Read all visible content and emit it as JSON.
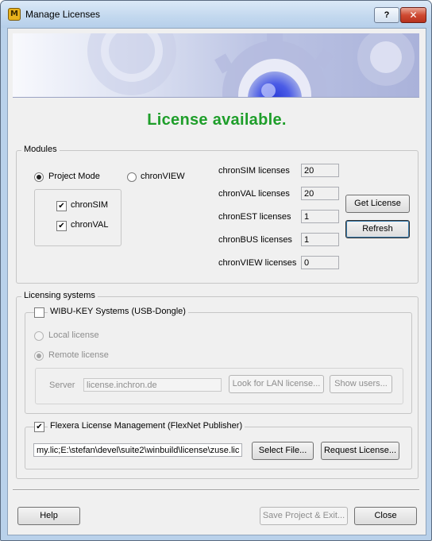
{
  "window": {
    "title": "Manage Licenses",
    "help_glyph": "?",
    "close_glyph": "✕",
    "app_icon_glyph": "M"
  },
  "status": {
    "text": "License available.",
    "color": "#1e9e2a"
  },
  "modules": {
    "title": "Modules",
    "mode_project": "Project Mode",
    "mode_view": "chronVIEW",
    "selected_mode": "Project Mode",
    "sim": {
      "label": "chronSIM",
      "checked": true
    },
    "val": {
      "label": "chronVAL",
      "checked": true
    },
    "licenses": [
      {
        "label": "chronSIM licenses",
        "value": "20"
      },
      {
        "label": "chronVAL licenses",
        "value": "20"
      },
      {
        "label": "chronEST licenses",
        "value": "1"
      },
      {
        "label": "chronBUS licenses",
        "value": "1"
      },
      {
        "label": "chronVIEW licenses",
        "value": "0"
      }
    ],
    "get_license": "Get License",
    "refresh": "Refresh"
  },
  "licensing": {
    "title": "Licensing systems",
    "wibu": {
      "label": "WIBU-KEY Systems (USB-Dongle)",
      "checked": false,
      "local": "Local license",
      "remote": "Remote license",
      "selected": "Remote license",
      "server_label": "Server",
      "server_value": "license.inchron.de",
      "look_lan": "Look for LAN license...",
      "show_users": "Show users..."
    },
    "flexera": {
      "label": "Flexera License Management (FlexNet Publisher)",
      "checked": true,
      "path": "my.lic;E:\\stefan\\devel\\suite2\\winbuild\\license\\zuse.lic",
      "select_file": "Select File...",
      "request_license": "Request License..."
    }
  },
  "footer": {
    "help": "Help",
    "save_exit": "Save Project & Exit...",
    "close": "Close"
  },
  "banner": {
    "icon": "gear-artwork"
  }
}
